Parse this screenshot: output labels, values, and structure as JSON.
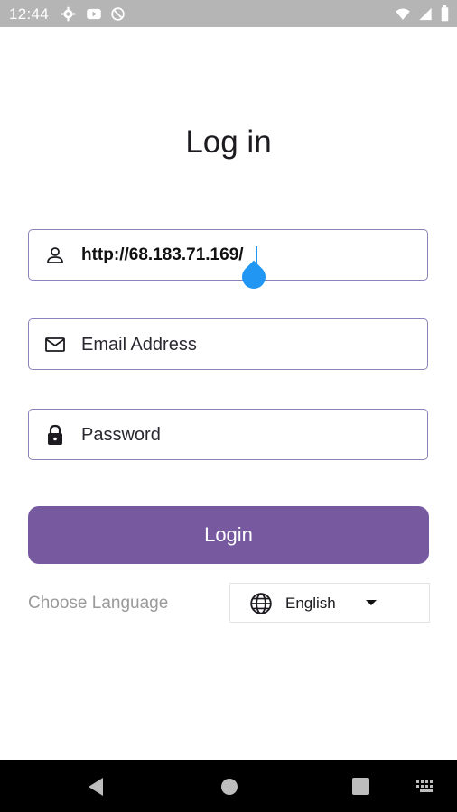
{
  "status_bar": {
    "time": "12:44",
    "icons": [
      "settings-icon",
      "youtube-icon",
      "no-sync-icon",
      "wifi-icon",
      "signal-icon",
      "battery-icon"
    ]
  },
  "page": {
    "title": "Log in"
  },
  "server_field": {
    "value": "http://68.183.71.169/",
    "icon": "person-icon"
  },
  "email_field": {
    "placeholder": "Email Address",
    "icon": "mail-icon"
  },
  "password_field": {
    "placeholder": "Password",
    "icon": "lock-icon"
  },
  "login_button": {
    "label": "Login",
    "color": "#7759a0"
  },
  "language": {
    "label": "Choose Language",
    "selected": "English",
    "icon": "globe-icon"
  },
  "nav_bar": {
    "icons": [
      "back-icon",
      "home-icon",
      "recents-icon",
      "keyboard-icon"
    ]
  },
  "colors": {
    "accent": "#7759a0",
    "field_border": "#8a82b8",
    "cursor": "#2196f3"
  }
}
